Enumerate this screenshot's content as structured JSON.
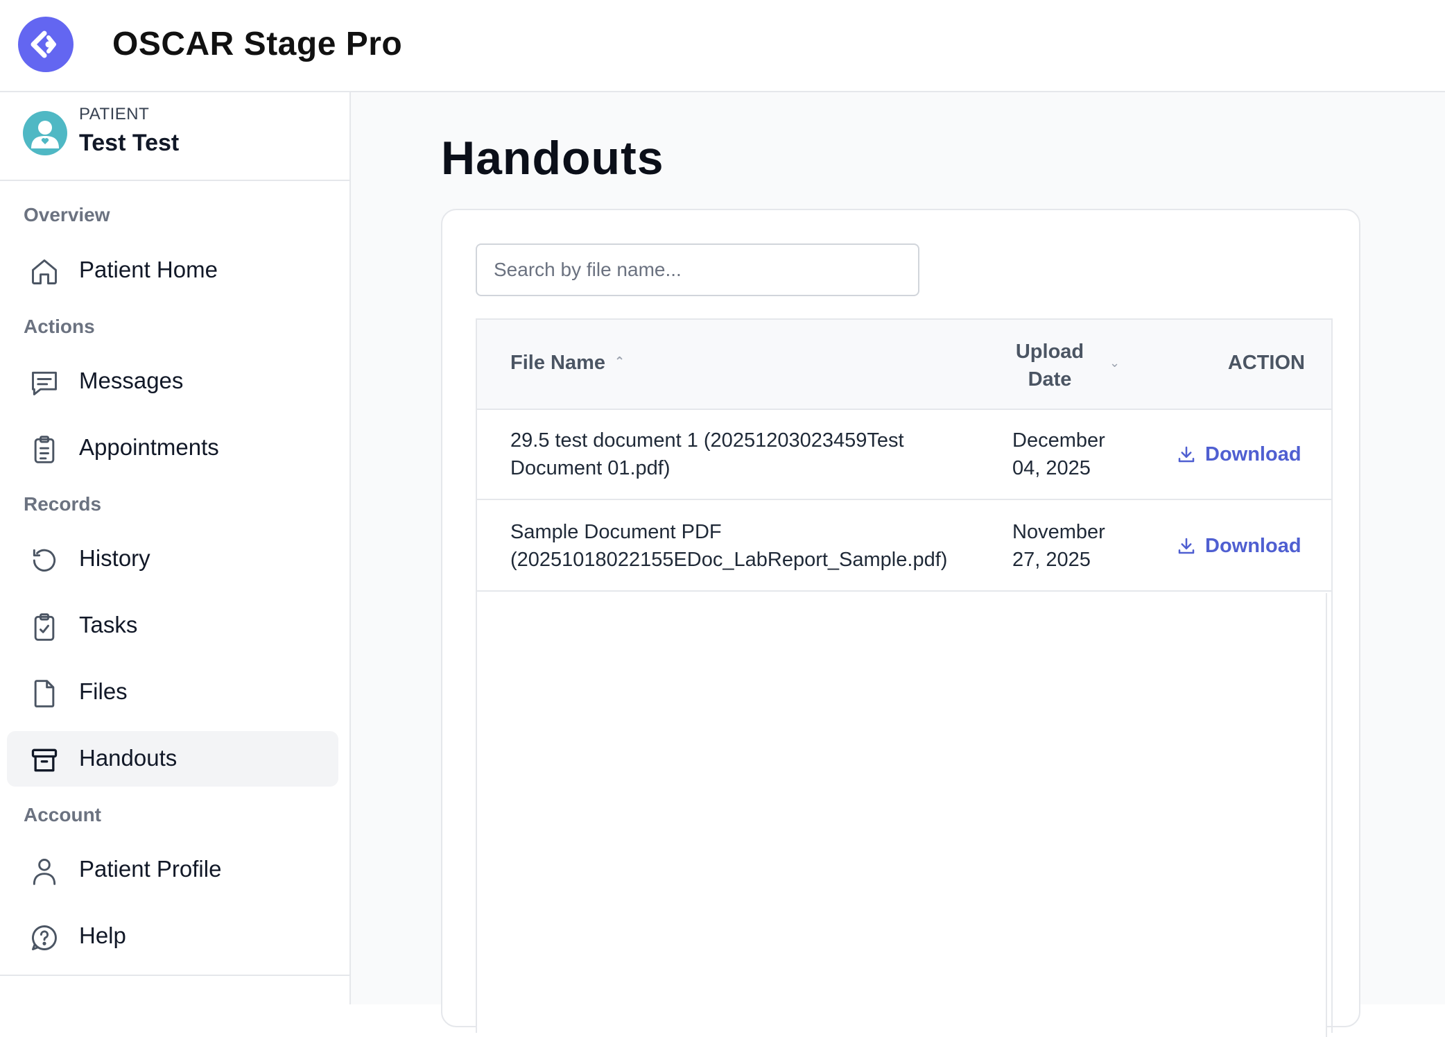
{
  "app": {
    "title": "OSCAR Stage Pro"
  },
  "patient": {
    "kicker": "PATIENT",
    "name": "Test Test"
  },
  "sidebar": {
    "sections": [
      {
        "label": "Overview"
      },
      {
        "label": "Actions"
      },
      {
        "label": "Records"
      },
      {
        "label": "Account"
      }
    ],
    "items": [
      {
        "label": "Patient Home",
        "icon": "home-icon"
      },
      {
        "label": "Messages",
        "icon": "message-icon"
      },
      {
        "label": "Appointments",
        "icon": "clipboard-list-icon"
      },
      {
        "label": "History",
        "icon": "history-icon"
      },
      {
        "label": "Tasks",
        "icon": "clipboard-check-icon"
      },
      {
        "label": "Files",
        "icon": "file-icon"
      },
      {
        "label": "Handouts",
        "icon": "archive-icon",
        "active": true
      },
      {
        "label": "Patient Profile",
        "icon": "user-icon"
      },
      {
        "label": "Help",
        "icon": "help-icon"
      }
    ]
  },
  "main": {
    "title": "Handouts",
    "search": {
      "placeholder": "Search by file name...",
      "value": ""
    },
    "table": {
      "headers": {
        "file_name": "File Name",
        "upload_date": "Upload Date",
        "action": "ACTION"
      },
      "rows": [
        {
          "file_name": "29.5 test document 1 (20251203023459Test Document 01.pdf)",
          "upload_date": "December 04, 2025",
          "action": "Download"
        },
        {
          "file_name": "Sample Document PDF (20251018022155EDoc_LabReport_Sample.pdf)",
          "upload_date": "November 27, 2025",
          "action": "Download"
        }
      ]
    }
  },
  "colors": {
    "accent": "#6366f1",
    "link": "#4f5fd1",
    "avatar": "#4fb8c4",
    "active_bg": "#f3f4f6"
  }
}
